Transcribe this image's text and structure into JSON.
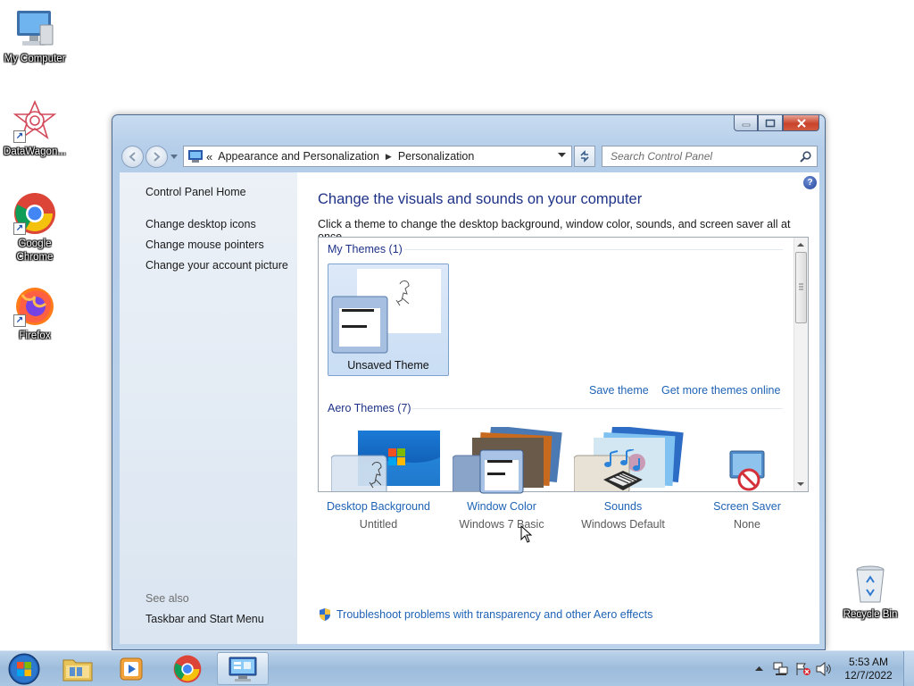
{
  "desktop": {
    "icons": [
      {
        "label": "My Computer",
        "icon": "computer-icon"
      },
      {
        "label": "DataWagon...",
        "icon": "datawagon-icon"
      },
      {
        "label": "Google Chrome",
        "icon": "chrome-icon"
      },
      {
        "label": "Firefox",
        "icon": "firefox-icon"
      },
      {
        "label": "Recycle Bin",
        "icon": "recycle-bin-icon"
      }
    ]
  },
  "window": {
    "address": {
      "overflow": "«",
      "crumbs": [
        "Appearance and Personalization",
        "Personalization"
      ]
    },
    "search": {
      "placeholder": "Search Control Panel"
    },
    "sidebar": {
      "home": "Control Panel Home",
      "links": [
        "Change desktop icons",
        "Change mouse pointers",
        "Change your account picture"
      ],
      "see_also": "See also",
      "see_also_links": [
        "Taskbar and Start Menu"
      ]
    },
    "main": {
      "heading": "Change the visuals and sounds on your computer",
      "subtext": "Click a theme to change the desktop background, window color, sounds, and screen saver all at once.",
      "my_themes": "My Themes (1)",
      "unsaved_theme": "Unsaved Theme",
      "save_theme": "Save theme",
      "get_more": "Get more themes online",
      "aero_themes": "Aero Themes (7)",
      "items": [
        {
          "label": "Desktop Background",
          "value": "Untitled",
          "icon": "desktop-background-icon"
        },
        {
          "label": "Window Color",
          "value": "Windows 7 Basic",
          "icon": "window-color-icon"
        },
        {
          "label": "Sounds",
          "value": "Windows Default",
          "icon": "sounds-icon"
        },
        {
          "label": "Screen Saver",
          "value": "None",
          "icon": "screen-saver-icon"
        }
      ],
      "troubleshoot": "Troubleshoot problems with transparency and other Aero effects"
    }
  },
  "taskbar": {
    "time": "5:53 AM",
    "date": "12/7/2022"
  }
}
